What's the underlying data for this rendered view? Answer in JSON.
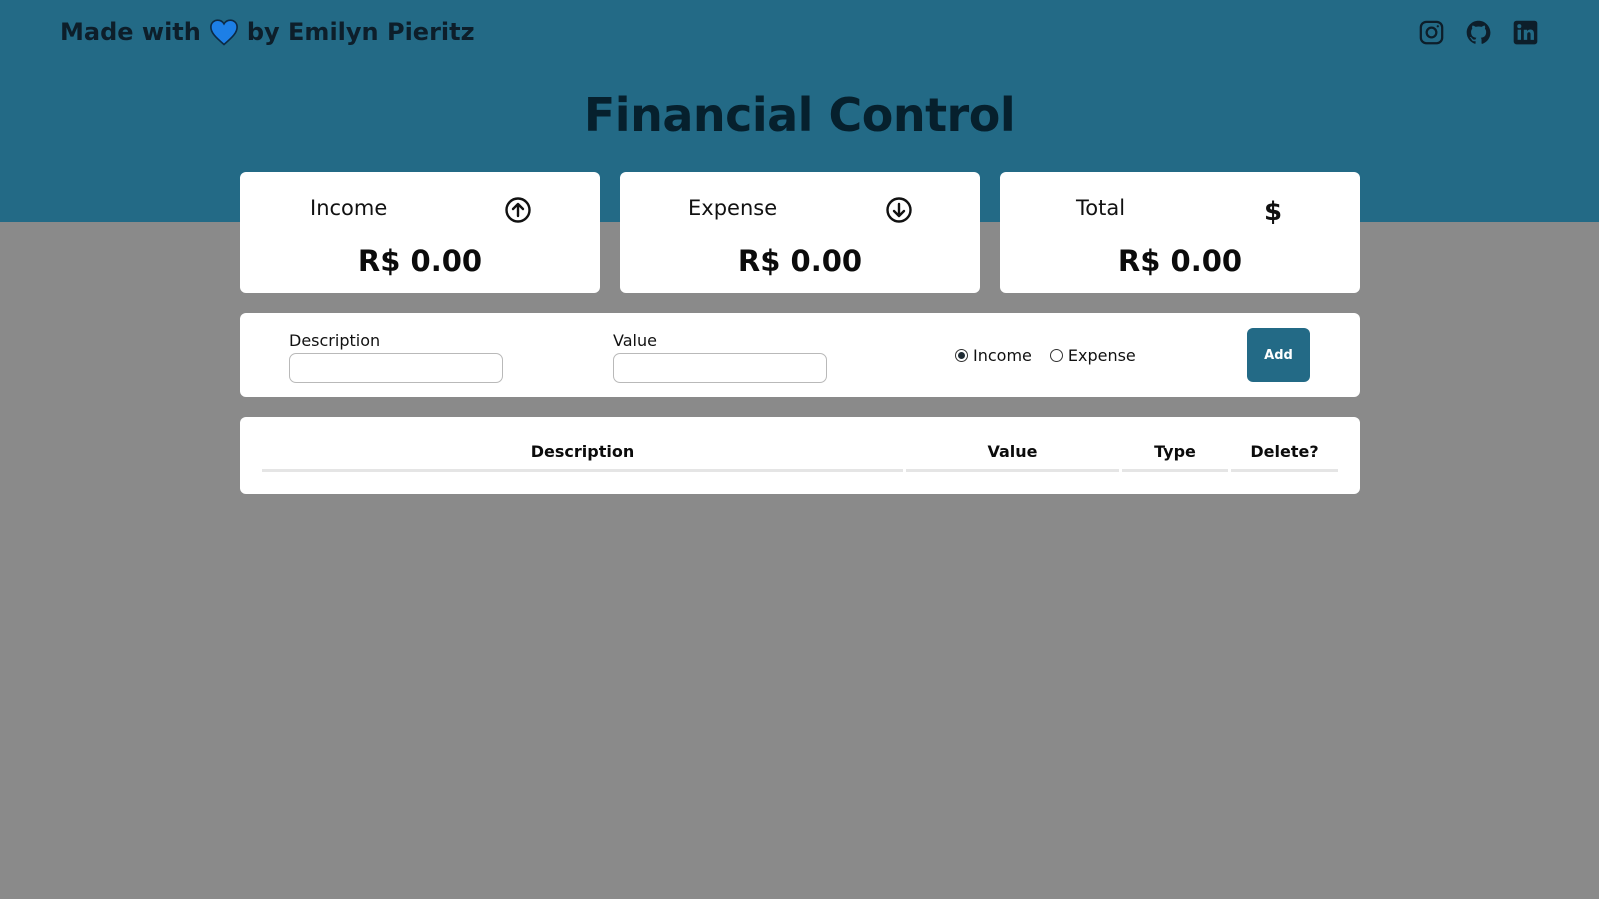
{
  "header": {
    "credit_prefix": "Made with",
    "credit_suffix": "by Emilyn Pieritz",
    "heart_icon": "heart-icon",
    "heart_color": "#1d7fe6",
    "socials": [
      {
        "name": "instagram-icon"
      },
      {
        "name": "github-icon"
      },
      {
        "name": "linkedin-icon"
      }
    ],
    "title": "Financial Control",
    "band_color": "#236a86"
  },
  "summary": {
    "income": {
      "label": "Income",
      "value": "R$ 0.00",
      "icon": "arrow-up-circle-icon"
    },
    "expense": {
      "label": "Expense",
      "value": "R$ 0.00",
      "icon": "arrow-down-circle-icon"
    },
    "total": {
      "label": "Total",
      "value": "R$ 0.00",
      "icon": "dollar-icon"
    }
  },
  "form": {
    "description_label": "Description",
    "description_value": "",
    "value_label": "Value",
    "value_value": "",
    "radio_income": "Income",
    "radio_expense": "Expense",
    "selected_type": "Income",
    "add_label": "Add"
  },
  "table": {
    "headers": [
      "Description",
      "Value",
      "Type",
      "Delete?"
    ],
    "rows": []
  }
}
